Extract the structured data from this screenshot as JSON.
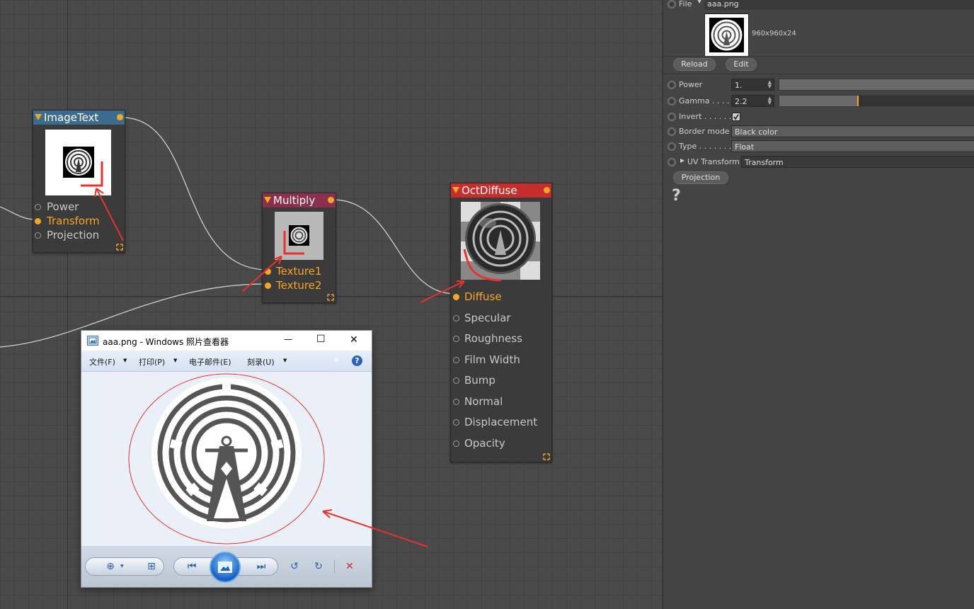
{
  "nodes": {
    "image_text": {
      "title": "ImageText",
      "ports": [
        {
          "label": "Power",
          "connected": false
        },
        {
          "label": "Transform",
          "connected": true
        },
        {
          "label": "Projection",
          "connected": false
        }
      ]
    },
    "multiply": {
      "title": "Multiply",
      "ports": [
        {
          "label": "Texture1",
          "connected": true
        },
        {
          "label": "Texture2",
          "connected": true
        }
      ]
    },
    "oct_diffuse": {
      "title": "OctDiffuse",
      "ports": [
        {
          "label": "Diffuse",
          "connected": true
        },
        {
          "label": "Specular",
          "connected": false
        },
        {
          "label": "Roughness",
          "connected": false
        },
        {
          "label": "Film Width",
          "connected": false
        },
        {
          "label": "Bump",
          "connected": false
        },
        {
          "label": "Normal",
          "connected": false
        },
        {
          "label": "Displacement",
          "connected": false
        },
        {
          "label": "Opacity",
          "connected": false
        }
      ]
    }
  },
  "panel": {
    "file_label": "File",
    "file_value": "aaa.png",
    "image_info": "960x960x24",
    "reload_label": "Reload",
    "edit_label": "Edit",
    "power_label": "Power",
    "power_value": "1.",
    "power_level": 1.0,
    "gamma_label": "Gamma . . . .",
    "gamma_value": "2.2",
    "gamma_level": 0.4,
    "invert_label": "Invert . . . . . .",
    "invert_checked": true,
    "border_mode_label": "Border mode",
    "border_mode_value": "Black color",
    "type_label": "Type . . . . . . .",
    "type_value": "Float",
    "uv_transform_label": "UV Transform",
    "uv_transform_value": "Transform",
    "projection_label": "Projection",
    "help_glyph": "?"
  },
  "viewer": {
    "title": "aaa.png - Windows 照片查看器",
    "menus": [
      "文件(F)",
      "打印(P)",
      "电子邮件(E)",
      "刻录(U)"
    ],
    "minimize_glyph": "—",
    "maximize_glyph": "☐",
    "close_glyph": "✕",
    "overflow_glyph": "»",
    "help_glyph": "?"
  },
  "colors": {
    "image_text_header": "#3d6b8c",
    "multiply_header": "#8c3050",
    "oct_diffuse_header": "#c62d2d",
    "port_active": "#f5a623",
    "annotation": "#e8322c"
  },
  "icons": [
    "dropdown-triangle-icon",
    "resize-icon",
    "zoom-icon",
    "fit-icon",
    "previous-icon",
    "slideshow-icon",
    "next-icon",
    "rotate-left-icon",
    "rotate-right-icon",
    "delete-icon",
    "help-icon"
  ]
}
